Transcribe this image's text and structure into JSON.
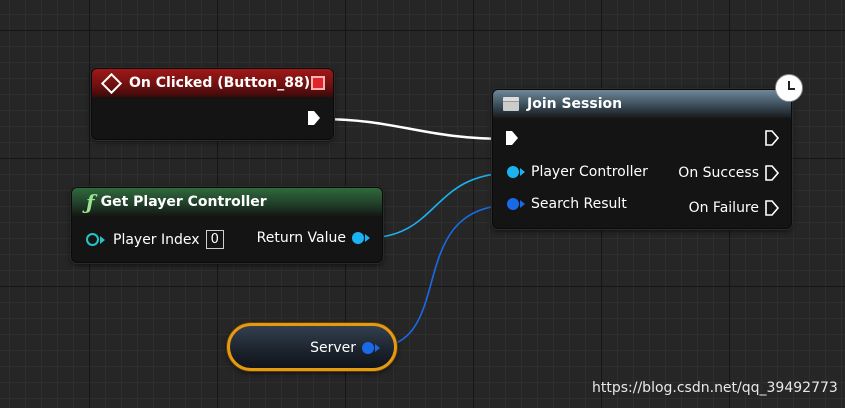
{
  "nodes": {
    "on_clicked": {
      "title": "On Clicked (Button_88)",
      "color": "#a01818"
    },
    "get_player_controller": {
      "title": "Get Player Controller",
      "icon": "function-f-icon",
      "inputs": [
        {
          "label": "Player Index",
          "value": "0"
        }
      ],
      "outputs": [
        {
          "label": "Return Value"
        }
      ],
      "color": "#2f6a3c"
    },
    "join_session": {
      "title": "Join Session",
      "inputs": [
        {
          "label": "Player Controller"
        },
        {
          "label": "Search Result"
        }
      ],
      "outputs": [
        {
          "label": "On Success"
        },
        {
          "label": "On Failure"
        }
      ],
      "color": "#6e8799",
      "latent_icon": "clock-icon"
    },
    "server_variable": {
      "label": "Server",
      "border_color": "#e59a13"
    }
  },
  "colors": {
    "exec_wire": "#ffffff",
    "object_wire": "#1ab2f0",
    "struct_wire": "#1a6ae8",
    "integer_pin": "#25c5c5"
  },
  "watermark": "https://blog.csdn.net/qq_39492773"
}
